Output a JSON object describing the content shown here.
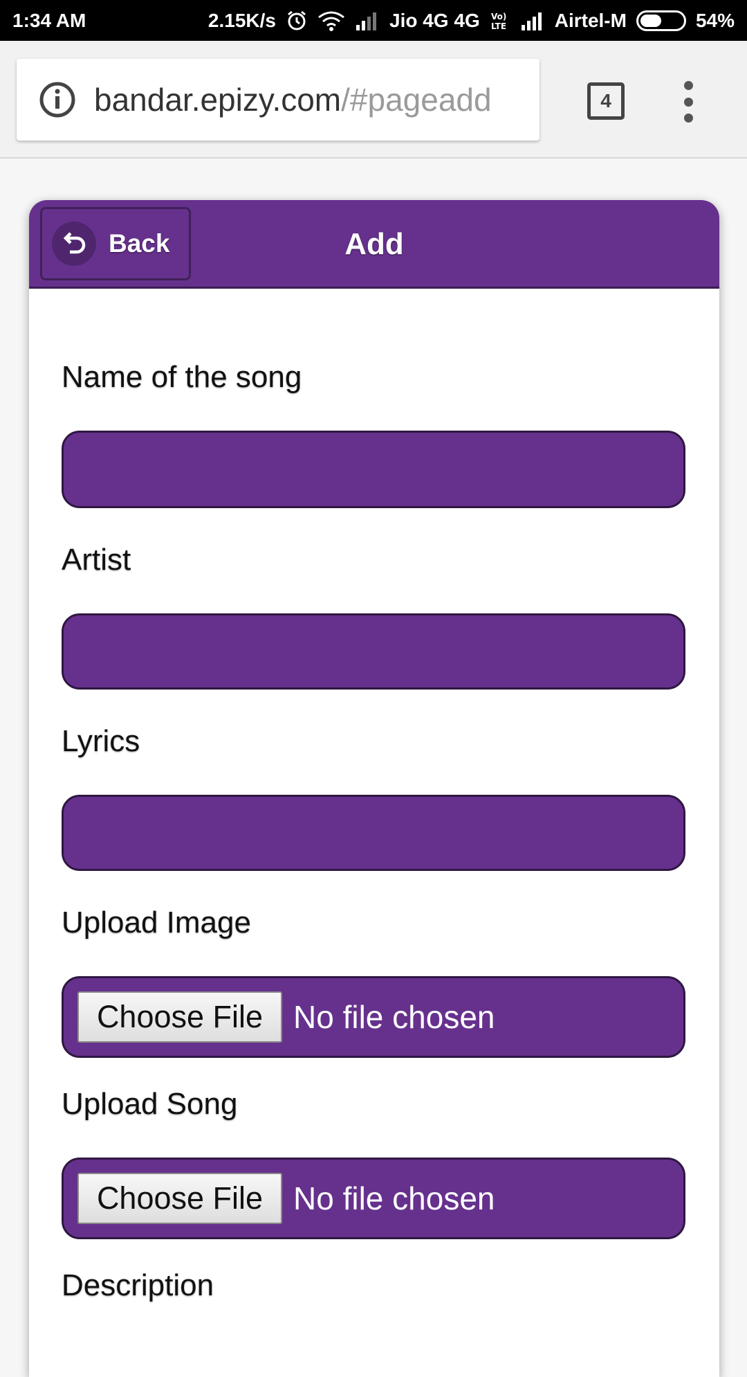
{
  "status_bar": {
    "time": "1:34 AM",
    "speed": "2.15K/s",
    "carrier1": "Jio 4G 4G",
    "carrier2": "Airtel-M",
    "battery": "54%",
    "battery_level": 0.54
  },
  "browser": {
    "url_host": "bandar.epizy.com",
    "url_path": "/#pageadd",
    "tab_count": "4"
  },
  "header": {
    "back_label": "Back",
    "title": "Add"
  },
  "form": {
    "song_name_label": "Name of the song",
    "artist_label": "Artist",
    "lyrics_label": "Lyrics",
    "upload_image_label": "Upload Image",
    "upload_song_label": "Upload Song",
    "description_label": "Description",
    "choose_file_label": "Choose File",
    "no_file_text": "No file chosen"
  },
  "colors": {
    "accent": "#66318d",
    "status_bar": "#000000"
  }
}
